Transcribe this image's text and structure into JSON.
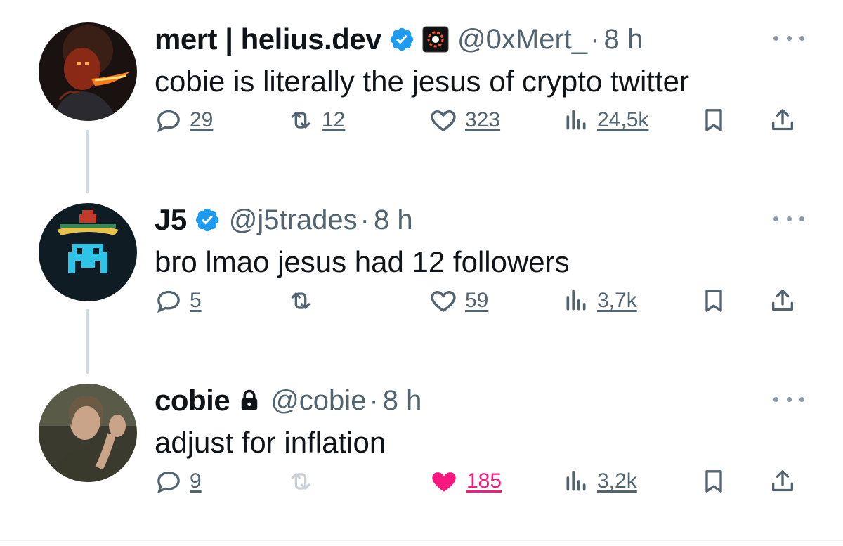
{
  "colors": {
    "verified": "#1d9bf0",
    "muted": "#536471",
    "like_active": "#f91880",
    "thread_line": "#cfd9de"
  },
  "tweets": [
    {
      "display_name": "mert | helius.dev",
      "handle": "@0xMert_",
      "separator": "·",
      "time": "8 h",
      "verified": true,
      "affiliate_badge": true,
      "text": "cobie is literally the jesus of crypto twitter",
      "replies": "29",
      "reposts": "12",
      "likes": "323",
      "views": "24,5k",
      "liked": false
    },
    {
      "display_name": "J5",
      "handle": "@j5trades",
      "separator": "·",
      "time": "8 h",
      "verified": true,
      "text": "bro lmao jesus had 12 followers",
      "replies": "5",
      "reposts": "",
      "likes": "59",
      "views": "3,7k",
      "liked": false
    },
    {
      "display_name": "cobie",
      "handle": "@cobie",
      "separator": "·",
      "time": "8 h",
      "protected": true,
      "text": "adjust for inflation",
      "replies": "9",
      "reposts": "",
      "likes": "185",
      "views": "3,2k",
      "liked": true
    }
  ]
}
